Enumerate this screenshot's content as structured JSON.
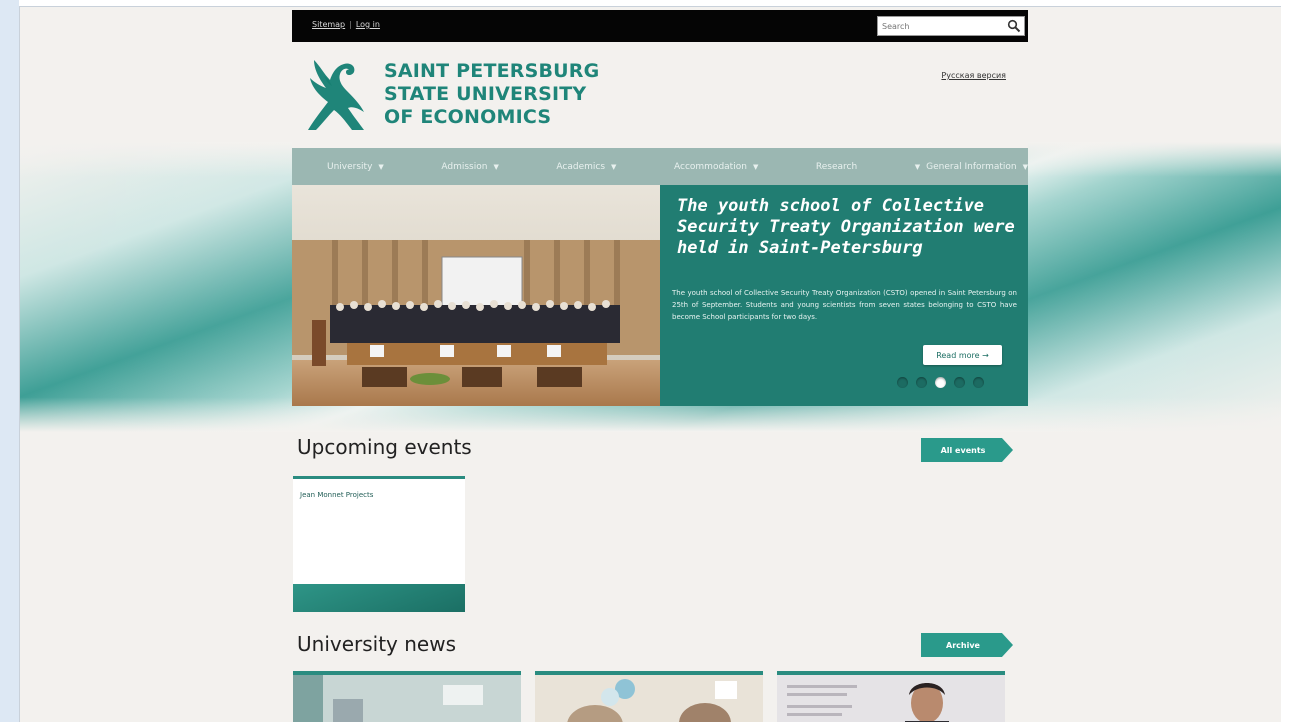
{
  "topbar": {
    "sitemap_label": "Sitemap",
    "separator": "|",
    "login_label": "Log in",
    "search_placeholder": "Search"
  },
  "header": {
    "logo_line1": "SAINT PETERSBURG",
    "logo_line2": "STATE UNIVERSITY",
    "logo_line3": "OF ECONOMICS",
    "language_link": "Русская версия"
  },
  "nav": {
    "items": [
      {
        "label": "University",
        "has_dropdown": true
      },
      {
        "label": "Admission",
        "has_dropdown": true
      },
      {
        "label": "Academics",
        "has_dropdown": true
      },
      {
        "label": "Accommodation",
        "has_dropdown": true
      },
      {
        "label": "Research",
        "has_dropdown": false
      },
      {
        "label": "General Information",
        "has_dropdown": true
      }
    ],
    "caret_glyph": "▼"
  },
  "slider": {
    "title": "The youth school of Collective Security Treaty Organization were held in Saint-Petersburg",
    "description": "The youth school of Collective Security Treaty Organization (CSTO) opened in Saint Petersburg on 25th of September. Students and young scientists from seven states belonging to CSTO have become School participants for two days.",
    "read_more_label": "Read more →",
    "dot_count": 5,
    "active_dot": 2
  },
  "events": {
    "title": "Upcoming events",
    "all_label": "All events",
    "items": [
      {
        "title": "Jean Monnet Projects"
      }
    ]
  },
  "news": {
    "title": "University news",
    "archive_label": "Archive"
  },
  "colors": {
    "brand_teal": "#1f8579",
    "nav_bg": "#9bb7b2",
    "slide_bg": "#217d72",
    "button_teal": "#2a9a8b",
    "topbar_bg": "#050505"
  }
}
